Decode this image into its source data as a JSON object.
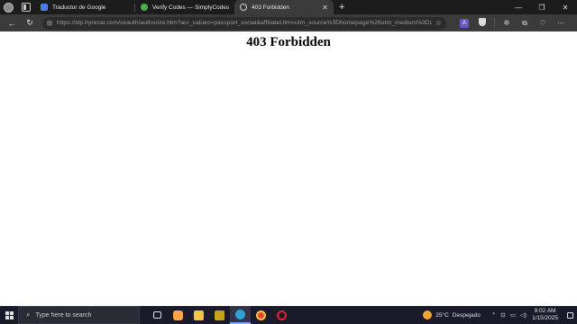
{
  "browser": {
    "tabs": [
      {
        "title": "Traductor de Google",
        "favicon_color": "#4a7ee6",
        "active": false
      },
      {
        "title": "Verify Codes — SimplyCodes",
        "favicon_color": "#4caf50",
        "active": false
      },
      {
        "title": "403 Forbidden",
        "favicon_color": "#9e9e9e",
        "active": true
      }
    ],
    "url": "https://idp.hyrecar.com/oxauth/authorize.htm?acr_values=passport_social&affiliateUtm=utm_source%3Dhomepage%26utm_medium%3Ddrive...",
    "extensions": [
      "A"
    ]
  },
  "page": {
    "heading": "403 Forbidden"
  },
  "taskbar": {
    "search_placeholder": "Type here to search",
    "weather_temp": "25°C",
    "weather_desc": "Despejado",
    "time": "9:02 AM",
    "date": "1/15/2025"
  }
}
